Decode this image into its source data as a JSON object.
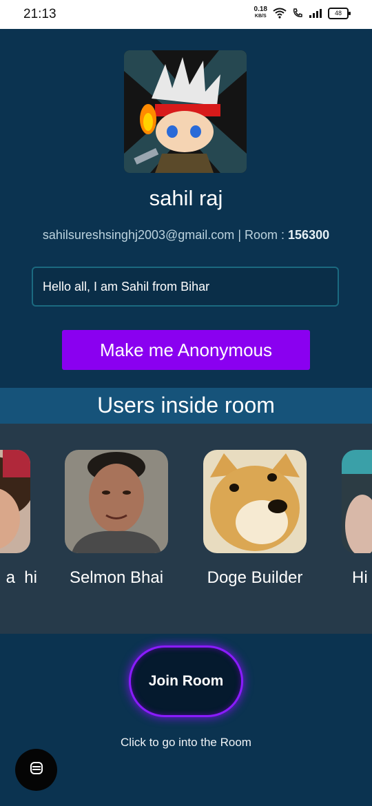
{
  "status_bar": {
    "time": "21:13",
    "net_speed": "0.18",
    "net_unit": "KB/S",
    "battery": "48"
  },
  "profile": {
    "name": "sahil raj",
    "email": "sahilsureshsinghj2003@gmail.com",
    "room_label": "| Room :",
    "room_id": "156300",
    "bio": "Hello all, I am Sahil from Bihar"
  },
  "actions": {
    "anonymous_label": "Make me Anonymous",
    "join_label": "Join Room",
    "join_hint": "Click to go into the Room"
  },
  "users_section": {
    "title": "Users inside room",
    "users": [
      {
        "name": "a  hi"
      },
      {
        "name": "Selmon Bhai"
      },
      {
        "name": "Doge Builder"
      },
      {
        "name": "Hi"
      }
    ]
  },
  "icons": {
    "fab": "chat-bubble-icon",
    "accent": "#8a00f0",
    "header_bg": "#16537a"
  }
}
